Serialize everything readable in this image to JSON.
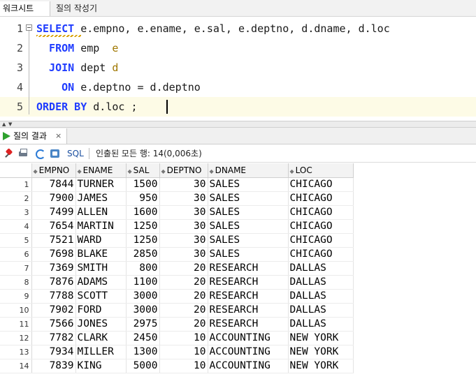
{
  "tabs": [
    {
      "label": "워크시트"
    },
    {
      "label": "질의 작성기"
    }
  ],
  "editor": {
    "lines": [
      {
        "num": "1",
        "segments": [
          {
            "t": "SELECT",
            "c": "kw"
          },
          {
            "t": " e.empno, e.ename, e.sal, e.deptno, d.dname, d.loc",
            "c": ""
          }
        ]
      },
      {
        "num": "2",
        "segments": [
          {
            "t": "  FROM",
            "c": "kw"
          },
          {
            "t": " emp  ",
            "c": ""
          },
          {
            "t": "e",
            "c": "alias"
          }
        ]
      },
      {
        "num": "3",
        "segments": [
          {
            "t": "  JOIN",
            "c": "kw"
          },
          {
            "t": " dept ",
            "c": ""
          },
          {
            "t": "d",
            "c": "alias"
          }
        ]
      },
      {
        "num": "4",
        "segments": [
          {
            "t": "    ON",
            "c": "kw"
          },
          {
            "t": " e.deptno = d.deptno",
            "c": ""
          }
        ]
      },
      {
        "num": "5",
        "segments": [
          {
            "t": "ORDER BY",
            "c": "kw"
          },
          {
            "t": " d.loc ;",
            "c": ""
          }
        ]
      }
    ]
  },
  "result_tab": {
    "label": "질의 결과",
    "close": "×"
  },
  "toolbar": {
    "sql_label": "SQL",
    "status": "인출된 모든 행: 14(0,006초)"
  },
  "grid": {
    "columns": [
      {
        "label": "EMPNO"
      },
      {
        "label": "ENAME"
      },
      {
        "label": "SAL"
      },
      {
        "label": "DEPTNO"
      },
      {
        "label": "DNAME"
      },
      {
        "label": "LOC"
      }
    ],
    "rows": [
      [
        "1",
        "7844",
        "TURNER",
        "1500",
        "30",
        "SALES",
        "CHICAGO"
      ],
      [
        "2",
        "7900",
        "JAMES",
        "950",
        "30",
        "SALES",
        "CHICAGO"
      ],
      [
        "3",
        "7499",
        "ALLEN",
        "1600",
        "30",
        "SALES",
        "CHICAGO"
      ],
      [
        "4",
        "7654",
        "MARTIN",
        "1250",
        "30",
        "SALES",
        "CHICAGO"
      ],
      [
        "5",
        "7521",
        "WARD",
        "1250",
        "30",
        "SALES",
        "CHICAGO"
      ],
      [
        "6",
        "7698",
        "BLAKE",
        "2850",
        "30",
        "SALES",
        "CHICAGO"
      ],
      [
        "7",
        "7369",
        "SMITH",
        "800",
        "20",
        "RESEARCH",
        "DALLAS"
      ],
      [
        "8",
        "7876",
        "ADAMS",
        "1100",
        "20",
        "RESEARCH",
        "DALLAS"
      ],
      [
        "9",
        "7788",
        "SCOTT",
        "3000",
        "20",
        "RESEARCH",
        "DALLAS"
      ],
      [
        "10",
        "7902",
        "FORD",
        "3000",
        "20",
        "RESEARCH",
        "DALLAS"
      ],
      [
        "11",
        "7566",
        "JONES",
        "2975",
        "20",
        "RESEARCH",
        "DALLAS"
      ],
      [
        "12",
        "7782",
        "CLARK",
        "2450",
        "10",
        "ACCOUNTING",
        "NEW YORK"
      ],
      [
        "13",
        "7934",
        "MILLER",
        "1300",
        "10",
        "ACCOUNTING",
        "NEW YORK"
      ],
      [
        "14",
        "7839",
        "KING",
        "5000",
        "10",
        "ACCOUNTING",
        "NEW YORK"
      ]
    ]
  }
}
